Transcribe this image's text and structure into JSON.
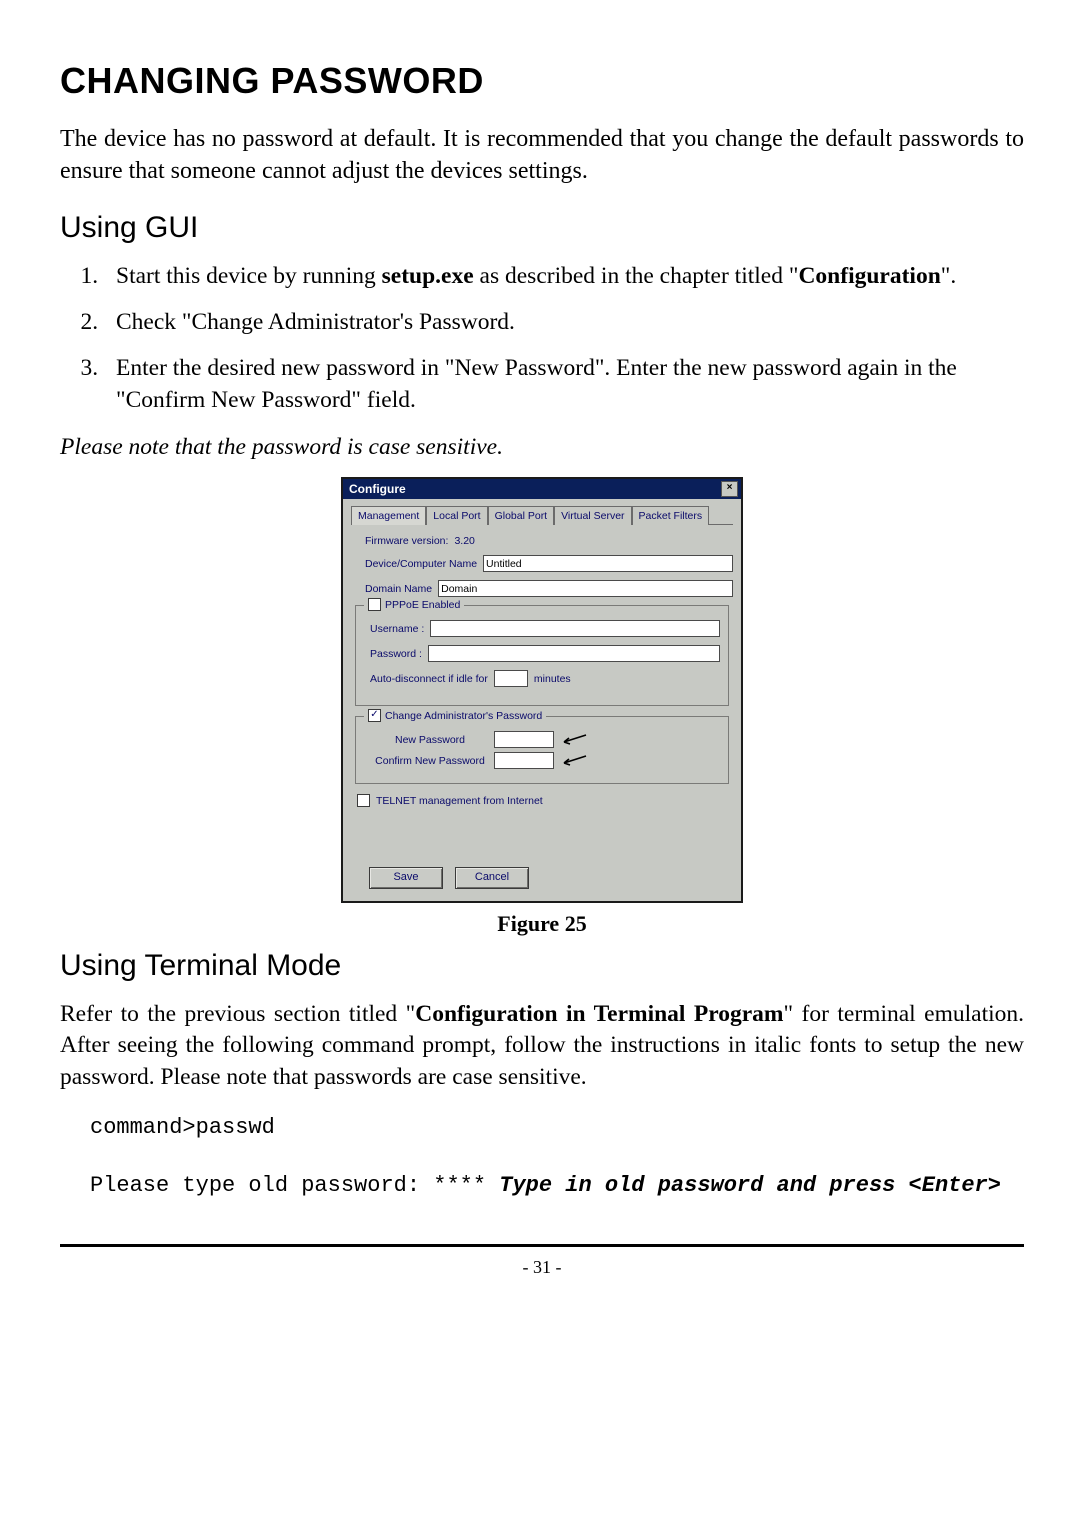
{
  "h1": "CHANGING PASSWORD",
  "intro": "The device has no password at default.  It is recommended that you change the default passwords to ensure that someone cannot adjust the devices settings.",
  "h2_gui": "Using GUI",
  "steps": [
    "Start this device by running setup.exe as described in the chapter titled \"Configuration\".",
    "Check \"Change Administrator's Password.",
    "Enter the desired new password in \"New Password\". Enter the new password again in the \"Confirm New Password\" field."
  ],
  "step1_pre": "Start this device by running ",
  "step1_bold1": "setup.exe",
  "step1_mid": " as described in the chapter titled \"",
  "step1_bold2": "Configuration",
  "step1_post": "\".",
  "step2": "Check \"Change Administrator's Password.",
  "step3": "Enter the desired new password in \"New Password\". Enter the new password again in the \"Confirm New Password\" field.",
  "note": "Please note that the password is case sensitive.",
  "fig_label": "Figure 25",
  "h2_term": "Using Terminal Mode",
  "term_para_pre": "Refer to the previous section titled \"",
  "term_para_bold": "Configuration in Terminal Program",
  "term_para_post": "\" for terminal emulation. After seeing the following command prompt, follow the instructions in italic fonts to setup the new password.  Please note that passwords are case sensitive.",
  "term_line1": "command>passwd",
  "term_line2a": "Please type old password: **** ",
  "term_line2b": "Type in old password and press <Enter>",
  "page_num": "- 31 -",
  "dlg": {
    "title": "Configure",
    "tabs": [
      "Management",
      "Local Port",
      "Global Port",
      "Virtual Server",
      "Packet Filters"
    ],
    "fw_label": "Firmware version:",
    "fw_value": "3.20",
    "devname_label": "Device/Computer Name",
    "devname_value": "Untitled",
    "domain_label": "Domain Name",
    "domain_value": "Domain",
    "pppoe_label": "PPPoE Enabled",
    "username_label": "Username :",
    "password_label": "Password :",
    "auto_label_pre": "Auto-disconnect if idle for",
    "auto_label_post": "minutes",
    "chgpwd_label": "Change Administrator's Password",
    "newpwd_label": "New Password",
    "confpwd_label": "Confirm New Password",
    "telnet_label": "TELNET management from Internet",
    "save": "Save",
    "cancel": "Cancel"
  }
}
